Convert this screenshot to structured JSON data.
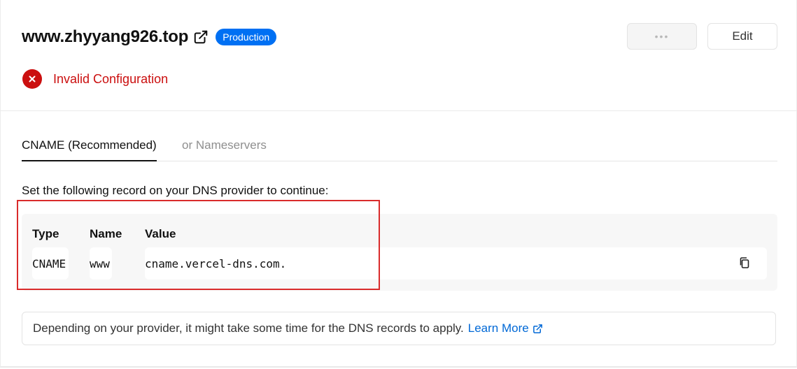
{
  "domain": {
    "name": "www.zhyyang926.top",
    "environment_badge": "Production",
    "external_icon": "external-link-icon"
  },
  "actions": {
    "more_label": "•••",
    "edit_label": "Edit"
  },
  "status": {
    "icon": "x-circle-icon",
    "text": "Invalid Configuration",
    "color": "#cb0f0f"
  },
  "tabs": [
    {
      "label": "CNAME (Recommended)",
      "active": true
    },
    {
      "label": "or Nameservers",
      "active": false
    }
  ],
  "instructions": "Set the following record on your DNS provider to continue:",
  "record": {
    "headers": {
      "type": "Type",
      "name": "Name",
      "value": "Value"
    },
    "type": "CNAME",
    "name": "www",
    "value": "cname.vercel-dns.com.",
    "copy_icon": "copy-icon"
  },
  "note": {
    "text": "Depending on your provider, it might take some time for the DNS records to apply.",
    "link_label": "Learn More",
    "link_icon": "external-link-icon"
  },
  "colors": {
    "accent": "#0070f3",
    "link": "#0068d6",
    "error": "#cb0f0f",
    "highlight": "#d92b2b"
  }
}
